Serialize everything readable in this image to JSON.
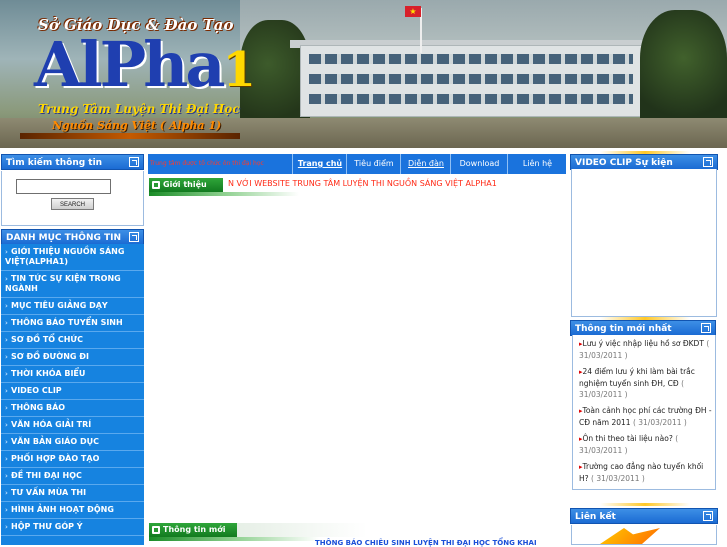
{
  "banner": {
    "top_text": "Sở Giáo Dục & Đào Tạo",
    "logo_text": "AlPha",
    "logo_num": "1",
    "subtitle1": "Trung Tâm Luyện Thi Đại Học",
    "subtitle2": "Nguồn Sáng Việt ( Alpha 1)"
  },
  "left": {
    "search_title": "Tìm kiếm thông tin",
    "search_placeholder": "",
    "search_button": "SEARCH",
    "menu_title": "DANH MỤC THÔNG TIN",
    "menu_items": [
      "GIỚI THIỆU NGUỒN SÁNG VIỆT(ALPHA1)",
      "TIN TỨC SỰ KIỆN TRONG NGÀNH",
      "MỤC TIÊU GIẢNG DẠY",
      "THÔNG BÁO TUYỂN SINH",
      "SƠ ĐỒ TỔ CHỨC",
      "SƠ ĐỒ ĐƯỜNG ĐI",
      "THỜI KHÓA BIỂU",
      "VIDEO CLIP",
      "THÔNG BÁO",
      "VĂN HÓA GIẢI TRÍ",
      "VĂN BẢN GIÁO DỤC",
      "PHỐI HỢP ĐÀO TẠO",
      "ĐỀ THI ĐẠI HỌC",
      "TƯ VẤN MÙA THI",
      "HÌNH ẢNH HOẠT ĐỘNG",
      "HỘP THƯ GÓP Ý"
    ]
  },
  "nav": {
    "marquee": "Trung tâm được tổ chức ôn thi đại học",
    "tabs": [
      "Trang chủ",
      "Tiêu điểm",
      "Diễn đàn",
      "Download",
      "Liên hệ"
    ]
  },
  "main": {
    "intro_tab": "Giới thiệu",
    "welcome": "N VỚI WEBSITE TRUNG TÂM LUYỆN THI NGUỒN SÁNG VIỆT ALPHA1",
    "news_tab": "Thông tin mới",
    "bottom_marquee": "THÔNG BÁO CHIÊU SINH LUYỆN THI ĐẠI HỌC TỔNG KHAI"
  },
  "right": {
    "video_title": "VIDEO CLIP Sự kiện",
    "latest_title": "Thông tin mới nhất",
    "latest": [
      {
        "text": "Lưu ý việc nhập liệu hồ sơ ĐKDT",
        "date": "( 31/03/2011 )"
      },
      {
        "text": "24 điểm lưu ý khi làm bài trắc nghiệm tuyển sinh ĐH, CĐ",
        "date": "( 31/03/2011 )"
      },
      {
        "text": "Toàn cảnh học phí các trường ĐH - CĐ năm 2011",
        "date": "( 31/03/2011 )"
      },
      {
        "text": "Ôn thi theo tài liệu nào?",
        "date": "( 31/03/2011 )"
      },
      {
        "text": "Trường cao đẳng nào tuyển khối H?",
        "date": "( 31/03/2011 )"
      }
    ],
    "links_title": "Liên kết"
  },
  "colors": {
    "nav_blue": "#1a73dd",
    "menu_blue": "#1683e0",
    "accent_red": "#ff2a16",
    "tab_green": "#1a8c27"
  }
}
